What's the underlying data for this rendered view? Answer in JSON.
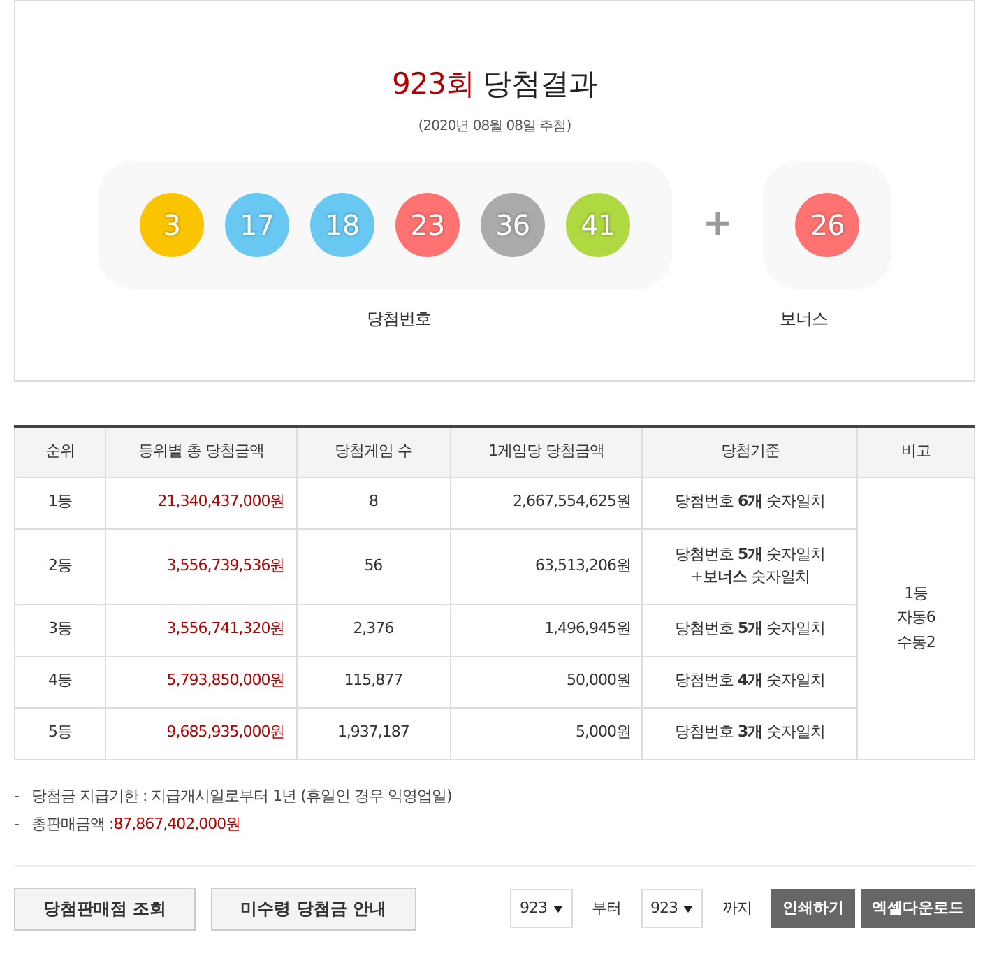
{
  "result": {
    "round": "923회",
    "title": "당첨결과",
    "date": "(2020년 08월 08일 추첨)",
    "balls": [
      {
        "number": "3",
        "color": "#fbc400"
      },
      {
        "number": "17",
        "color": "#69c8f2"
      },
      {
        "number": "18",
        "color": "#69c8f2"
      },
      {
        "number": "23",
        "color": "#ff7272"
      },
      {
        "number": "36",
        "color": "#aaaaaa"
      },
      {
        "number": "41",
        "color": "#b0d840"
      }
    ],
    "plus": "+",
    "bonus": {
      "number": "26",
      "color": "#ff7272"
    },
    "balls_label": "당첨번호",
    "bonus_label": "보너스"
  },
  "table": {
    "columns": [
      "순위",
      "등위별 총 당첨금액",
      "당첨게임 수",
      "1게임당 당첨금액",
      "당첨기준",
      "비고"
    ],
    "rows": [
      {
        "rank": "1등",
        "total": "21,340,437,000원",
        "winners": "8",
        "per_game": "2,667,554,625원",
        "criteria": [
          "당첨번호 **6개** 숫자일치"
        ]
      },
      {
        "rank": "2등",
        "total": "3,556,739,536원",
        "winners": "56",
        "per_game": "63,513,206원",
        "criteria": [
          "당첨번호 **5개** 숫자일치",
          "+**보너스** 숫자일치"
        ]
      },
      {
        "rank": "3등",
        "total": "3,556,741,320원",
        "winners": "2,376",
        "per_game": "1,496,945원",
        "criteria": [
          "당첨번호 **5개** 숫자일치"
        ]
      },
      {
        "rank": "4등",
        "total": "5,793,850,000원",
        "winners": "115,877",
        "per_game": "50,000원",
        "criteria": [
          "당첨번호 **4개** 숫자일치"
        ]
      },
      {
        "rank": "5등",
        "total": "9,685,935,000원",
        "winners": "1,937,187",
        "per_game": "5,000원",
        "criteria": [
          "당첨번호 **3개** 숫자일치"
        ]
      }
    ],
    "remarks": [
      "1등",
      "자동6",
      "수동2"
    ]
  },
  "notes": [
    {
      "bullet": "-",
      "label": "당첨금 지급기한 : 지급개시일로부터 1년 (휴일인 경우 익영업일)"
    },
    {
      "bullet": "-",
      "label": "총판매금액 : ",
      "value": "87,867,402,000원"
    }
  ],
  "buttons": [
    "당첨판매점 조회",
    "미수령 당첨금 안내"
  ],
  "range": {
    "from": "923",
    "from_label": "부터",
    "to": "923",
    "to_label": "까지"
  },
  "actions": [
    "인쇄하기",
    "엑셀다운로드"
  ]
}
